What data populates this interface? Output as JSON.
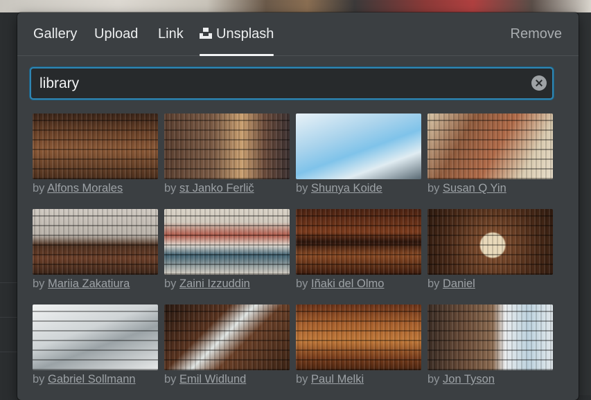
{
  "tabs": [
    {
      "label": "Gallery",
      "active": false
    },
    {
      "label": "Upload",
      "active": false
    },
    {
      "label": "Link",
      "active": false
    },
    {
      "label": "Unsplash",
      "active": true,
      "icon": "unsplash-icon"
    }
  ],
  "remove_label": "Remove",
  "search": {
    "value": "library",
    "clear_icon": "clear-search-icon"
  },
  "credit_prefix": "by ",
  "photos": [
    {
      "author": "Alfons Morales"
    },
    {
      "author": "ѕɪ Janko Ferlič"
    },
    {
      "author": "Shunya Koide"
    },
    {
      "author": "Susan Q Yin"
    },
    {
      "author": "Mariia Zakatiura"
    },
    {
      "author": "Zaini Izzuddin"
    },
    {
      "author": "Iñaki del Olmo"
    },
    {
      "author": "Daniel"
    },
    {
      "author": "Gabriel Sollmann"
    },
    {
      "author": "Emil Widlund"
    },
    {
      "author": "Paul Melki"
    },
    {
      "author": "Jon Tyson"
    }
  ],
  "colors": {
    "panel_bg": "#3b3f42",
    "accent_focus": "#2f86b3",
    "text_primary": "#eceeef",
    "text_muted": "#8f9498"
  }
}
